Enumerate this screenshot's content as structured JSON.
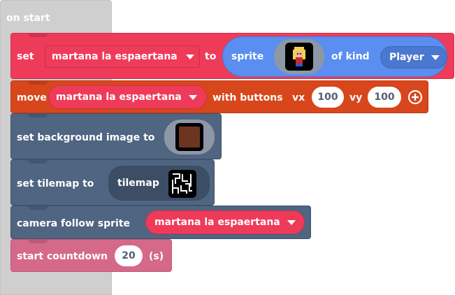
{
  "event": {
    "label": "on start"
  },
  "set_sprite": {
    "set_label": "set",
    "variable": "martana la espaertana",
    "to_label": "to",
    "sprite_label": "sprite",
    "of_kind_label": "of kind",
    "kind": "Player",
    "icon": "sprite-thumbnail"
  },
  "move_buttons": {
    "move_label": "move",
    "variable": "martana la espaertana",
    "with_buttons_label": "with buttons",
    "vx_label": "vx",
    "vx_value": "100",
    "vy_label": "vy",
    "vy_value": "100",
    "add_icon": "plus-circle-icon"
  },
  "background": {
    "label": "set background image to",
    "icon": "background-image-thumbnail",
    "color": "#6b3520"
  },
  "tilemap": {
    "label": "set tilemap to",
    "tilemap_label": "tilemap",
    "icon": "tilemap-thumbnail"
  },
  "camera": {
    "label": "camera follow sprite",
    "variable": "martana la espaertana"
  },
  "countdown": {
    "label": "start countdown",
    "value": "20",
    "unit": "(s)"
  },
  "colors": {
    "sprites_category": "#ef3b5a",
    "controller_category": "#d8461b",
    "scene_category": "#4f6581",
    "info_category": "#d5698a",
    "sprite_reporter": "#5a8ef0",
    "event_hat": "#cfcfcf"
  }
}
